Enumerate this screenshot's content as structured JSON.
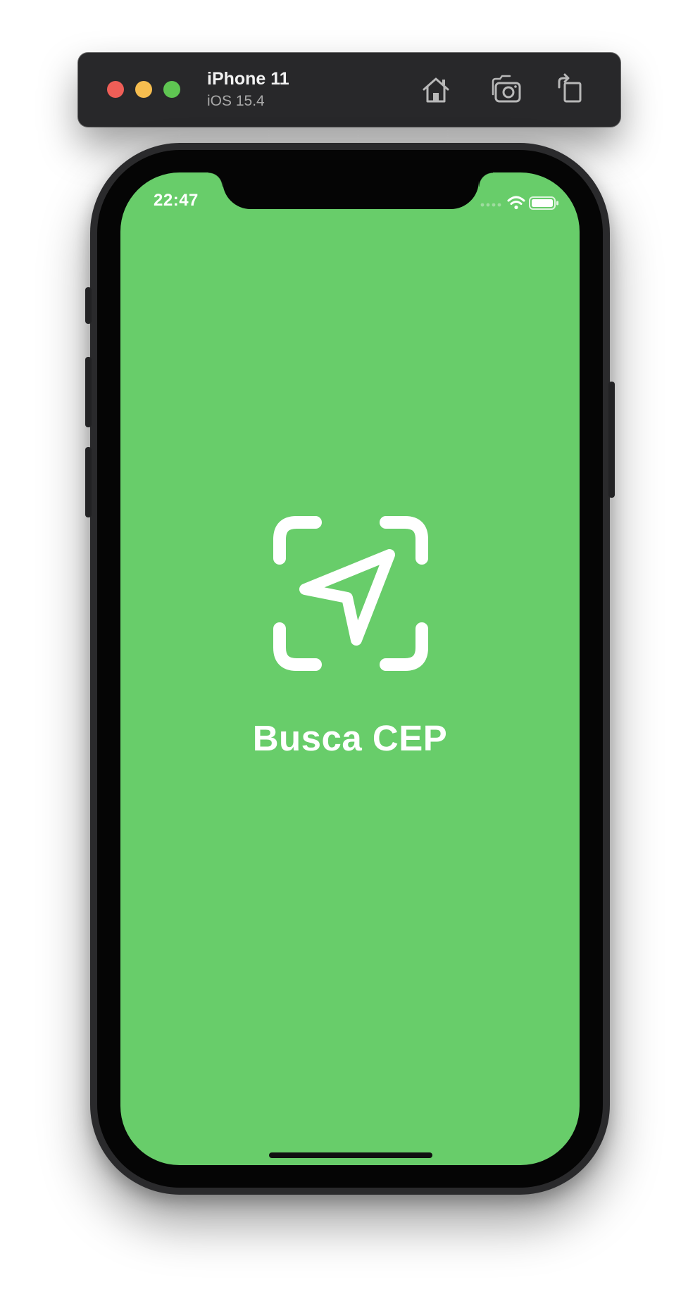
{
  "toolbar": {
    "device_name": "iPhone 11",
    "os_version": "iOS 15.4",
    "traffic_lights": [
      {
        "name": "close",
        "color": "#ee5e57"
      },
      {
        "name": "minimize",
        "color": "#f6bd4f"
      },
      {
        "name": "zoom",
        "color": "#5fc552"
      }
    ],
    "buttons": [
      {
        "name": "home",
        "icon": "home-icon"
      },
      {
        "name": "screenshot",
        "icon": "camera-icon"
      },
      {
        "name": "rotate",
        "icon": "rotate-icon"
      }
    ]
  },
  "status_bar": {
    "time": "22:47",
    "icons": [
      "cellular-signal-icon",
      "wifi-icon",
      "battery-icon"
    ]
  },
  "splash": {
    "background_color": "#68cd6a",
    "icon": "location-arrow-viewfinder-icon",
    "title": "Busca CEP"
  }
}
